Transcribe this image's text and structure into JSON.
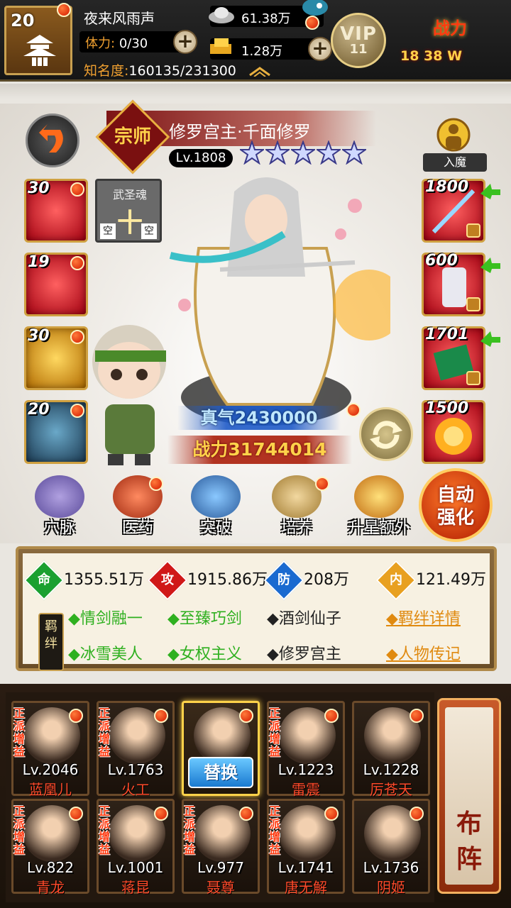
{
  "header": {
    "player_level": "20",
    "player_name": "夜来风雨声",
    "stamina_label": "体力:",
    "stamina_value": "0/30",
    "fame_label": "知名度:",
    "fame_value": "160135/231300",
    "silver": "61.38万",
    "gold": "1.28万",
    "vip_label": "VIP",
    "vip_level": "11",
    "power_label": "战力",
    "power_value": "18   38 W"
  },
  "hero": {
    "rank": "宗师",
    "name": "修罗宫主·千面修罗",
    "level": "Lv.1808",
    "stars": 5,
    "demon_label": "入魔",
    "qi": "真气2430000",
    "power": "战力31744014"
  },
  "left_slots": [
    {
      "count": "30",
      "style": "slot-red"
    },
    {
      "count": "19",
      "style": "slot-red"
    },
    {
      "count": "30",
      "style": "slot-gold"
    },
    {
      "count": "20",
      "style": "slot-blue"
    }
  ],
  "martial_soul": {
    "title": "武圣魂",
    "glyph": "十",
    "slot_left": "空",
    "slot_right": "空"
  },
  "right_slots": [
    {
      "count": "1800"
    },
    {
      "count": "600"
    },
    {
      "count": "1701"
    },
    {
      "count": "1500"
    }
  ],
  "functions": [
    {
      "label": "穴脉"
    },
    {
      "label": "医药"
    },
    {
      "label": "突破"
    },
    {
      "label": "培养"
    },
    {
      "label": "升星额外"
    }
  ],
  "auto_strengthen": {
    "line1": "自动",
    "line2": "强化"
  },
  "stats": [
    {
      "key": "命",
      "value": "1355.51万",
      "color": "#1aa030"
    },
    {
      "key": "攻",
      "value": "1915.86万",
      "color": "#d01818"
    },
    {
      "key": "防",
      "value": "208万",
      "color": "#1a6ad0"
    },
    {
      "key": "内",
      "value": "121.49万",
      "color": "#e8a020"
    }
  ],
  "bond_tag": "羁绊",
  "bonds": [
    {
      "label": "◆情剑融一",
      "active": true
    },
    {
      "label": "◆至臻巧剑",
      "active": true
    },
    {
      "label": "◆酒剑仙子",
      "active": false
    },
    {
      "label": "◆冰雪美人",
      "active": true
    },
    {
      "label": "◆女权主义",
      "active": true
    },
    {
      "label": "◆修罗宫主",
      "active": false
    }
  ],
  "links": {
    "bond_detail": "◆羁绊详情",
    "biography": "◆人物传记"
  },
  "roster": [
    {
      "tag": "正派增益",
      "level": "Lv.2046",
      "name": "蓝凰儿"
    },
    {
      "tag": "正派增益",
      "level": "Lv.1763",
      "name": "火工"
    },
    {
      "tag": "",
      "level": "",
      "name": "",
      "selected": true
    },
    {
      "tag": "正派增益",
      "level": "Lv.1223",
      "name": "雷震"
    },
    {
      "tag": "",
      "level": "Lv.1228",
      "name": "厉苍天"
    },
    {
      "tag": "正派增益",
      "level": "Lv.822",
      "name": "青龙"
    },
    {
      "tag": "正派增益",
      "level": "Lv.1001",
      "name": "蒋昆"
    },
    {
      "tag": "正派增益",
      "level": "Lv.977",
      "name": "聂尊"
    },
    {
      "tag": "正派增益",
      "level": "Lv.1741",
      "name": "唐无解"
    },
    {
      "tag": "",
      "level": "Lv.1736",
      "name": "阴姬"
    }
  ],
  "replace_label": "替换",
  "lineup": {
    "line1": "布",
    "line2": "阵"
  }
}
